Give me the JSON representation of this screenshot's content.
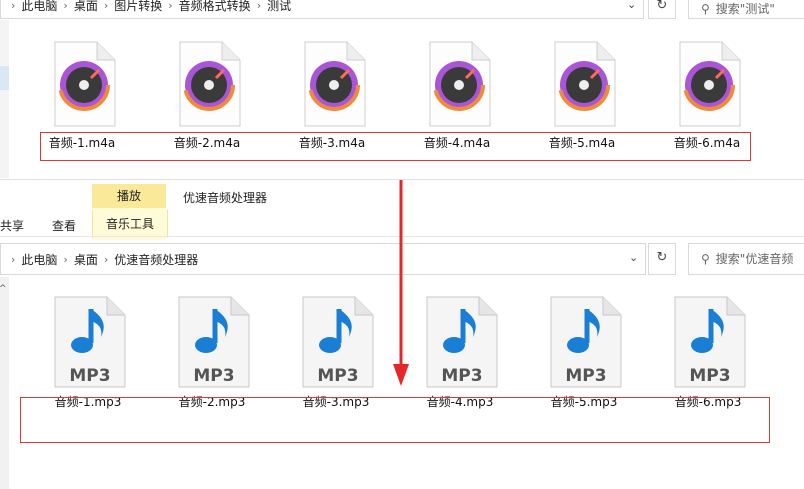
{
  "top_window": {
    "breadcrumbs": [
      "此电脑",
      "桌面",
      "图片转换",
      "音频格式转换",
      "测试"
    ],
    "search_placeholder": "搜索\"测试\"",
    "files": [
      "音频-1.m4a",
      "音频-2.m4a",
      "音频-3.m4a",
      "音频-4.m4a",
      "音频-5.m4a",
      "音频-6.m4a"
    ]
  },
  "bottom_window": {
    "ribbon": {
      "tab_share": "共享",
      "tab_view": "查看",
      "context_header": "播放",
      "context_tab": "音乐工具",
      "window_title": "优速音频处理器"
    },
    "breadcrumbs": [
      "此电脑",
      "桌面",
      "优速音频处理器"
    ],
    "search_placeholder": "搜索\"优速音频",
    "files": [
      "音频-1.mp3",
      "音频-2.mp3",
      "音频-3.mp3",
      "音频-4.mp3",
      "音频-5.mp3",
      "音频-6.mp3"
    ],
    "mp3_icon_text": "MP3"
  },
  "colors": {
    "highlight": "#d83a3a",
    "arrow": "#e8262a",
    "context_tab": "#fbe99a"
  }
}
